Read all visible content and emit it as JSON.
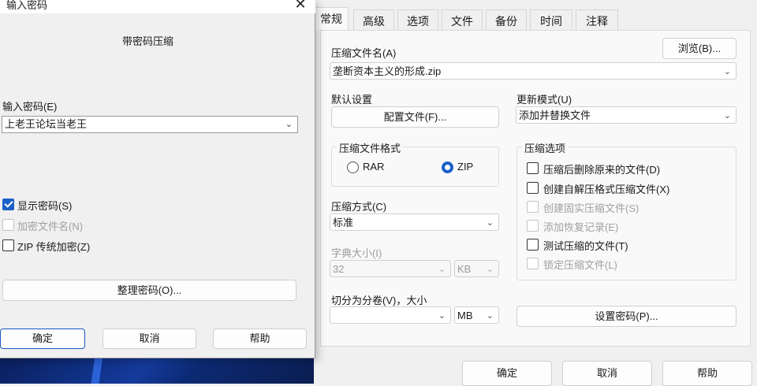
{
  "password_dialog": {
    "title": "输入密码",
    "subtitle": "带密码压缩",
    "password_label": "输入密码(E)",
    "password_value": "上老王论坛当老王",
    "show_password": {
      "label": "显示密码(S)",
      "checked": true
    },
    "encrypt_names": {
      "label": "加密文件名(N)",
      "checked": false,
      "disabled": true
    },
    "zip_legacy": {
      "label": "ZIP 传统加密(Z)",
      "checked": false
    },
    "organize_button": "整理密码(O)...",
    "ok_button": "确定",
    "cancel_button": "取消",
    "help_button": "帮助"
  },
  "archive_dialog": {
    "tabs": [
      "常规",
      "高级",
      "选项",
      "文件",
      "备份",
      "时间",
      "注释"
    ],
    "active_tab": "常规",
    "archive_name_label": "压缩文件名(A)",
    "browse_button": "浏览(B)...",
    "archive_name_value": "垄断资本主义的形成.zip",
    "default_settings_label": "默认设置",
    "profiles_button": "配置文件(F)...",
    "update_mode_label": "更新模式(U)",
    "update_mode_value": "添加并替换文件",
    "format_group": "压缩文件格式",
    "format_rar": "RAR",
    "format_zip": "ZIP",
    "selected_format": "ZIP",
    "method_label": "压缩方式(C)",
    "method_value": "标准",
    "dict_label": "字典大小(I)",
    "dict_value": "32",
    "dict_unit": "KB",
    "split_label": "切分为分卷(V)，大小",
    "split_value": "",
    "split_unit": "MB",
    "options_group": "压缩选项",
    "options": [
      {
        "label": "压缩后删除原来的文件(D)",
        "checked": false,
        "disabled": false
      },
      {
        "label": "创建自解压格式压缩文件(X)",
        "checked": false,
        "disabled": false
      },
      {
        "label": "创建固实压缩文件(S)",
        "checked": false,
        "disabled": true
      },
      {
        "label": "添加恢复记录(E)",
        "checked": false,
        "disabled": true
      },
      {
        "label": "测试压缩的文件(T)",
        "checked": false,
        "disabled": false
      },
      {
        "label": "锁定压缩文件(L)",
        "checked": false,
        "disabled": true
      }
    ],
    "set_password_button": "设置密码(P)...",
    "ok_button": "确定",
    "cancel_button": "取消",
    "help_button": "帮助"
  }
}
